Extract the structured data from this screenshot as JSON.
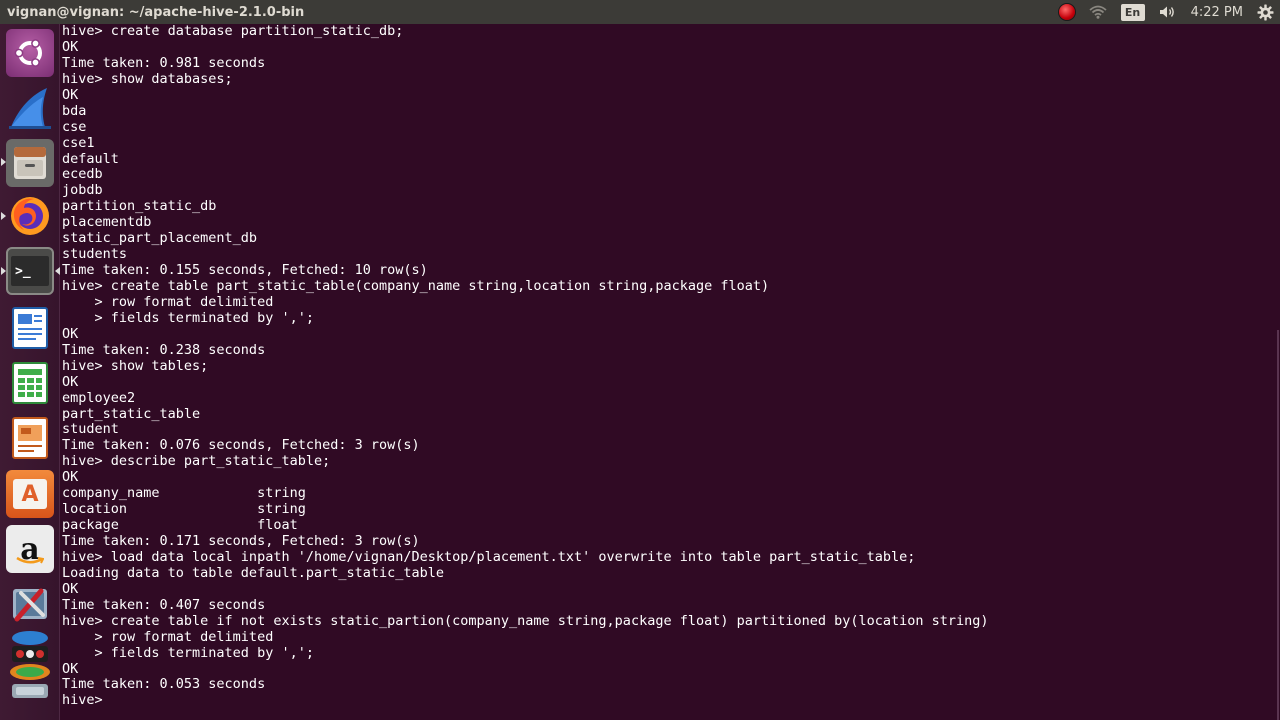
{
  "window": {
    "title": "vignan@vignan: ~/apache-hive-2.1.0-bin"
  },
  "panel": {
    "keyboard_layout": "En",
    "time": "4:22 PM"
  },
  "launcher": {
    "items": [
      {
        "id": "ubuntu",
        "icon": "ubuntu-logo-icon"
      },
      {
        "id": "wireshark",
        "icon": "wireshark-fin-icon"
      },
      {
        "id": "files",
        "icon": "file-cabinet-icon"
      },
      {
        "id": "firefox",
        "icon": "firefox-icon"
      },
      {
        "id": "terminal",
        "icon": "terminal-icon",
        "label": ">_"
      },
      {
        "id": "writer",
        "icon": "document-icon"
      },
      {
        "id": "calc",
        "icon": "spreadsheet-icon"
      },
      {
        "id": "impress",
        "icon": "presentation-icon"
      },
      {
        "id": "software",
        "icon": "software-center-icon",
        "label": "A"
      },
      {
        "id": "amazon",
        "icon": "amazon-icon",
        "label": "a"
      },
      {
        "id": "settings",
        "icon": "settings-tools-icon"
      },
      {
        "id": "app-stack",
        "icon": "app-stack-icon"
      }
    ]
  },
  "terminal": {
    "lines": [
      "hive> create database partition_static_db;",
      "OK",
      "Time taken: 0.981 seconds",
      "hive> show databases;",
      "OK",
      "bda",
      "cse",
      "cse1",
      "default",
      "ecedb",
      "jobdb",
      "partition_static_db",
      "placementdb",
      "static_part_placement_db",
      "students",
      "Time taken: 0.155 seconds, Fetched: 10 row(s)",
      "hive> create table part_static_table(company_name string,location string,package float)",
      "    > row format delimited",
      "    > fields terminated by ',';",
      "OK",
      "Time taken: 0.238 seconds",
      "hive> show tables;",
      "OK",
      "employee2",
      "part_static_table",
      "student",
      "Time taken: 0.076 seconds, Fetched: 3 row(s)",
      "hive> describe part_static_table;",
      "OK",
      "company_name            string",
      "location                string",
      "package                 float",
      "Time taken: 0.171 seconds, Fetched: 3 row(s)",
      "hive> load data local inpath '/home/vignan/Desktop/placement.txt' overwrite into table part_static_table;",
      "Loading data to table default.part_static_table",
      "OK",
      "Time taken: 0.407 seconds",
      "hive> create table if not exists static_partion(company_name string,package float) partitioned by(location string)",
      "    > row format delimited",
      "    > fields terminated by ',';",
      "OK",
      "Time taken: 0.053 seconds",
      "hive> "
    ]
  },
  "colors": {
    "terminal_bg": "#300a24",
    "panel_bg": "#3c3b37",
    "text": "#ffffff"
  }
}
